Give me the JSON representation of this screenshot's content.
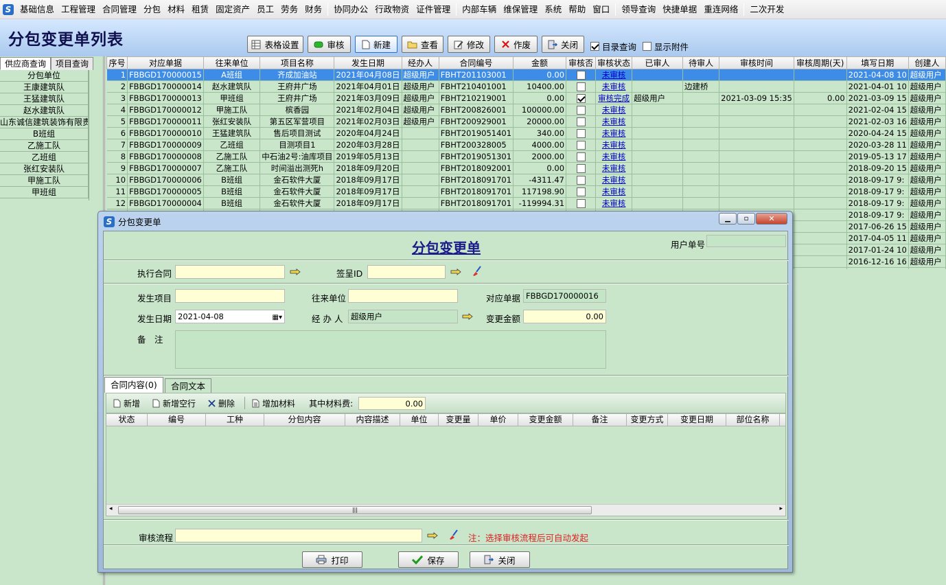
{
  "menu": [
    "基础信息",
    "工程管理",
    "合同管理",
    "分包",
    "材料",
    "租赁",
    "固定资产",
    "员工",
    "劳务",
    "财务",
    "协同办公",
    "行政物资",
    "证件管理",
    "内部车辆",
    "维保管理",
    "系统",
    "帮助",
    "窗口",
    "领导查询",
    "快捷单据",
    "重连网络",
    "二次开发"
  ],
  "page_title": "分包变更单列表",
  "toolbar": {
    "table_settings": "表格设置",
    "audit": "审核",
    "new": "新建",
    "view": "查看",
    "edit": "修改",
    "void": "作废",
    "close": "关闭",
    "catalog_query": "目录查询",
    "show_attachments": "显示附件"
  },
  "left_tabs": [
    "供应商查询",
    "项目查询"
  ],
  "left_list": [
    "分包单位",
    "王康建筑队",
    "王猛建筑队",
    "赵水建筑队",
    "山东诚信建筑装饰有限责",
    "B班组",
    "乙施工队",
    "乙班组",
    "张红安装队",
    "甲施工队",
    "甲班组"
  ],
  "grid": {
    "columns": [
      "序号",
      "对应单据",
      "往来单位",
      "项目名称",
      "发生日期",
      "经办人",
      "合同编号",
      "金额",
      "审核否",
      "审核状态",
      "已审人",
      "待审人",
      "审核时间",
      "审核周期(天)",
      "填写日期",
      "创建人"
    ],
    "rows": [
      [
        "1",
        "FBBGD170000015",
        "A班组",
        "齐成加油站",
        "2021年04月08日",
        "超级用户",
        "FBHT201103001",
        "0.00",
        "0",
        "未审核",
        "",
        "",
        "",
        "",
        "2021-04-08 10",
        "超级用户"
      ],
      [
        "2",
        "FBBGD170000014",
        "赵水建筑队",
        "王府井广场",
        "2021年04月01日",
        "超级用户",
        "FBHT210401001",
        "10400.00",
        "0",
        "未审核",
        "",
        "边建桥",
        "",
        "",
        "2021-04-01 10",
        "超级用户"
      ],
      [
        "3",
        "FBBGD170000013",
        "甲班组",
        "王府井广场",
        "2021年03月09日",
        "超级用户",
        "FBHT210219001",
        "0.00",
        "1",
        "审核完成",
        "超级用户",
        "",
        "2021-03-09 15:35",
        "0.00",
        "2021-03-09 15",
        "超级用户"
      ],
      [
        "4",
        "FBBGD170000012",
        "甲施工队",
        "槟香园",
        "2021年02月04日",
        "超级用户",
        "FBHT200826001",
        "100000.00",
        "0",
        "未审核",
        "",
        "",
        "",
        "",
        "2021-02-04 15",
        "超级用户"
      ],
      [
        "5",
        "FBBGD170000011",
        "张红安装队",
        "第五区军营项目",
        "2021年02月03日",
        "超级用户",
        "FBHT200929001",
        "20000.00",
        "0",
        "未审核",
        "",
        "",
        "",
        "",
        "2021-02-03 16",
        "超级用户"
      ],
      [
        "6",
        "FBBGD170000010",
        "王猛建筑队",
        "售后项目测试",
        "2020年04月24日",
        "",
        "FBHT2019051401",
        "340.00",
        "0",
        "未审核",
        "",
        "",
        "",
        "",
        "2020-04-24 15",
        "超级用户"
      ],
      [
        "7",
        "FBBGD170000009",
        "乙班组",
        "目测项目1",
        "2020年03月28日",
        "",
        "FBHT200328005",
        "4000.00",
        "0",
        "未审核",
        "",
        "",
        "",
        "",
        "2020-03-28 11",
        "超级用户"
      ],
      [
        "8",
        "FBBGD170000008",
        "乙施工队",
        "中石油2号:油库项目",
        "2019年05月13日",
        "",
        "FBHT2019051301",
        "2000.00",
        "0",
        "未审核",
        "",
        "",
        "",
        "",
        "2019-05-13 17",
        "超级用户"
      ],
      [
        "9",
        "FBBGD170000007",
        "乙施工队",
        "时间溢出测死h",
        "2018年09月20日",
        "",
        "FBHT2018092001",
        "0.00",
        "0",
        "未审核",
        "",
        "",
        "",
        "",
        "2018-09-20 15",
        "超级用户"
      ],
      [
        "10",
        "FBBGD170000006",
        "B班组",
        "金石软件大厦",
        "2018年09月17日",
        "",
        "FBHT2018091701",
        "-4311.47",
        "0",
        "未审核",
        "",
        "",
        "",
        "",
        "2018-09-17 9:",
        "超级用户"
      ],
      [
        "11",
        "FBBGD170000005",
        "B班组",
        "金石软件大厦",
        "2018年09月17日",
        "",
        "FBHT2018091701",
        "117198.90",
        "0",
        "未审核",
        "",
        "",
        "",
        "",
        "2018-09-17 9:",
        "超级用户"
      ],
      [
        "12",
        "FBBGD170000004",
        "B班组",
        "金石软件大厦",
        "2018年09月17日",
        "",
        "FBHT2018091701",
        "-119994.31",
        "0",
        "未审核",
        "",
        "",
        "",
        "",
        "2018-09-17 9:",
        "超级用户"
      ]
    ],
    "partial_rows": [
      [
        "2018-09-17 9:",
        "超级用户"
      ],
      [
        "2017-06-26 15",
        "超级用户"
      ],
      [
        "2017-04-05 11",
        "超级用户"
      ],
      [
        "2017-01-24 10",
        "超级用户"
      ],
      [
        "2016-12-16 16",
        "超级用户"
      ],
      [
        "2016-12-16 15",
        "超级用户"
      ]
    ]
  },
  "dialog": {
    "window_title": "分包变更单",
    "form_title": "分包变更单",
    "user_no_label": "用户单号",
    "user_no": "",
    "contract_label": "执行合同",
    "contract": "",
    "sign_id_label": "签呈ID",
    "sign_id": "",
    "project_label": "发生项目",
    "project": "",
    "party_label": "往来单位",
    "party": "",
    "voucher_label": "对应单据",
    "voucher": "FBBGD170000016",
    "date_label": "发生日期",
    "date": "2021-04-08",
    "handler_label": "经 办 人",
    "handler": "超级用户",
    "change_amount_label": "变更金额",
    "change_amount": "0.00",
    "remark_label": "备　注",
    "remark": "",
    "tabs": [
      "合同内容(0)",
      "合同文本"
    ],
    "subtoolbar": {
      "new": "新增",
      "new_empty": "新增空行",
      "delete": "删除",
      "add_material": "增加材料",
      "material_fee_label": "其中材料费:",
      "material_fee": "0.00"
    },
    "detail_columns": [
      "状态",
      "编号",
      "工种",
      "分包内容",
      "内容描述",
      "单位",
      "变更量",
      "单价",
      "变更金额",
      "备注",
      "变更方式",
      "变更日期",
      "部位名称"
    ],
    "flow_label": "审核流程",
    "flow": "",
    "flow_note": "注：选择审核流程后可自动发起",
    "print": "打印",
    "save": "保存",
    "close": "关闭"
  }
}
